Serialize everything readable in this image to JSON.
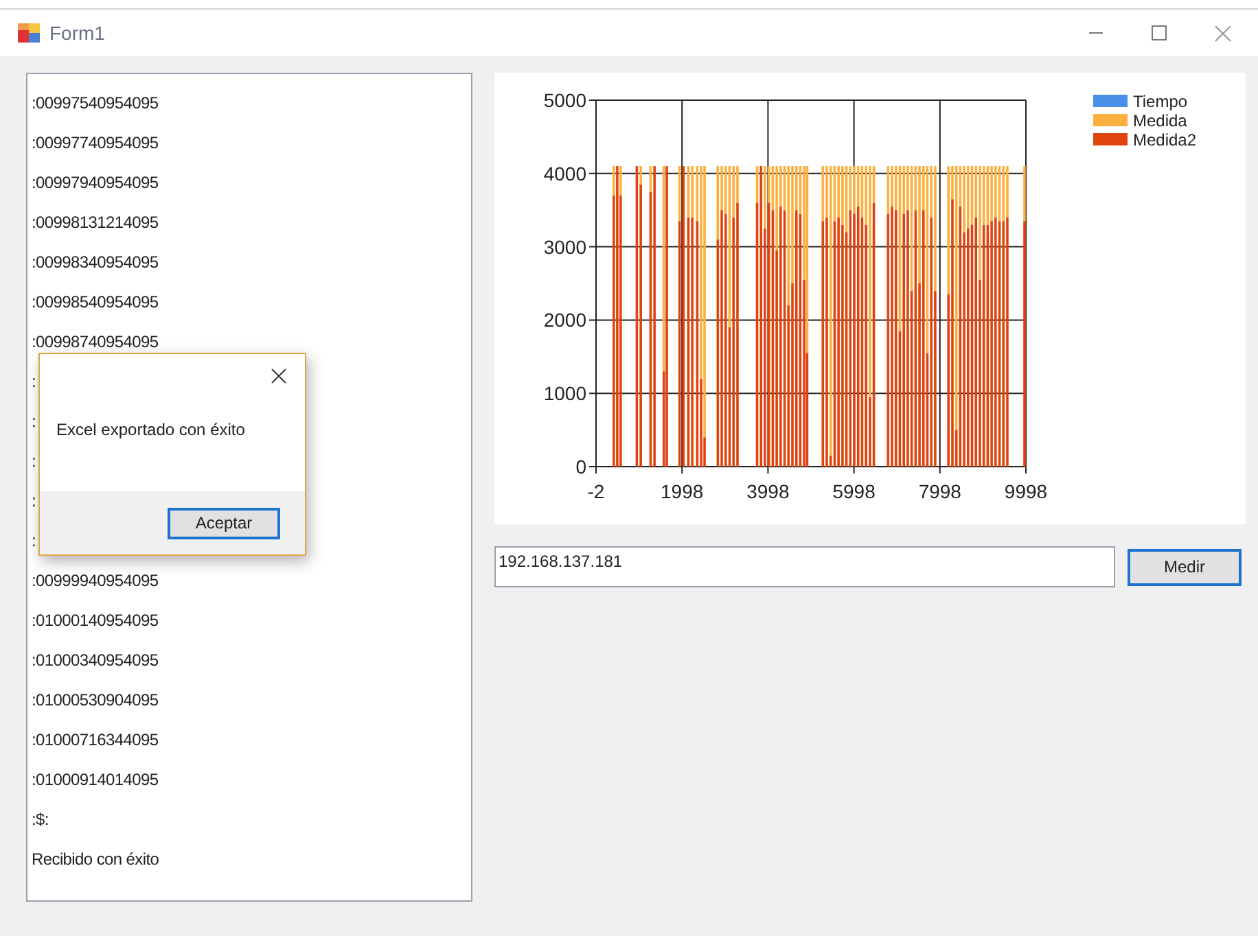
{
  "window": {
    "title": "Form1"
  },
  "log": {
    "items": [
      ":00997540954095",
      ":00997740954095",
      ":00997940954095",
      ":00998131214095",
      ":00998340954095",
      ":00998540954095",
      ":00998740954095",
      ":",
      ":",
      ":",
      ":",
      ":",
      ":00999940954095",
      ":01000140954095",
      ":01000340954095",
      ":01000530904095",
      ":01000716344095",
      ":01000914014095",
      ":$:",
      "Recibido con éxito"
    ]
  },
  "chart": {
    "chart_data": {
      "type": "bar",
      "stacked": true,
      "grid": true,
      "legend": "upper right",
      "xlim": [
        -2,
        9998
      ],
      "ylim": [
        0,
        5000
      ],
      "xticks": [
        -2,
        1998,
        3998,
        5998,
        7998,
        9998
      ],
      "yticks": [
        0,
        1000,
        2000,
        3000,
        4000,
        5000
      ],
      "x": [
        411,
        491,
        571,
        947,
        1039,
        1267,
        1358,
        1575,
        1644,
        1941,
        2032,
        2146,
        2237,
        2352,
        2443,
        2523,
        2831,
        2922,
        3014,
        3105,
        3196,
        3288,
        3744,
        3836,
        3927,
        4018,
        4110,
        4201,
        4292,
        4384,
        4475,
        4566,
        4658,
        4749,
        4840,
        4909,
        5274,
        5365,
        5457,
        5548,
        5639,
        5731,
        5822,
        5913,
        6005,
        6096,
        6187,
        6279,
        6370,
        6461,
        6792,
        6884,
        6975,
        7066,
        7158,
        7249,
        7340,
        7432,
        7523,
        7614,
        7705,
        7797,
        7888,
        8196,
        8288,
        8379,
        8470,
        8562,
        8653,
        8744,
        8836,
        8927,
        9018,
        9110,
        9201,
        9292,
        9384,
        9475,
        9566,
        9966
      ],
      "series": [
        {
          "name": "Tiempo",
          "color": "#4a90e8",
          "values": [
            0,
            0,
            0,
            0,
            0,
            0,
            0,
            0,
            0,
            0,
            0,
            0,
            0,
            0,
            0,
            0,
            0,
            0,
            0,
            0,
            0,
            0,
            0,
            0,
            0,
            0,
            0,
            0,
            0,
            0,
            0,
            0,
            0,
            0,
            0,
            0,
            0,
            0,
            0,
            0,
            0,
            0,
            0,
            0,
            0,
            0,
            0,
            0,
            0,
            0,
            0,
            0,
            0,
            0,
            0,
            0,
            0,
            0,
            0,
            0,
            0,
            0,
            0,
            0,
            0,
            0,
            0,
            0,
            0,
            0,
            0,
            0,
            0,
            0,
            0,
            0,
            0,
            0,
            0,
            0
          ]
        },
        {
          "name": "Medida",
          "color": "#fbb040",
          "values": [
            400,
            0,
            400,
            0,
            250,
            350,
            0,
            2800,
            0,
            750,
            0,
            700,
            700,
            750,
            2900,
            3700,
            1000,
            600,
            650,
            2200,
            700,
            500,
            500,
            0,
            850,
            500,
            600,
            1150,
            550,
            600,
            1900,
            1600,
            600,
            650,
            1550,
            2550,
            750,
            700,
            3950,
            750,
            700,
            800,
            900,
            600,
            650,
            550,
            700,
            800,
            3150,
            500,
            650,
            550,
            600,
            2250,
            650,
            600,
            1700,
            600,
            1600,
            600,
            2550,
            700,
            1700,
            1750,
            450,
            3600,
            550,
            900,
            850,
            800,
            700,
            1550,
            800,
            800,
            750,
            700,
            750,
            750,
            700,
            750
          ]
        },
        {
          "name": "Medida2",
          "color": "#e0440e",
          "values": [
            3700,
            4100,
            3700,
            4100,
            3850,
            3750,
            4100,
            1300,
            4100,
            3350,
            4100,
            3400,
            3400,
            3350,
            1200,
            400,
            3100,
            3500,
            3450,
            1900,
            3400,
            3600,
            3600,
            4100,
            3250,
            3600,
            3500,
            2950,
            3550,
            3500,
            2200,
            2500,
            3500,
            3450,
            2550,
            1550,
            3350,
            3400,
            150,
            3350,
            3400,
            3300,
            3200,
            3500,
            3450,
            3550,
            3400,
            3300,
            950,
            3600,
            3450,
            3550,
            3500,
            1850,
            3450,
            3500,
            2400,
            3500,
            2500,
            3500,
            1550,
            3400,
            2400,
            2350,
            3650,
            500,
            3550,
            3200,
            3250,
            3300,
            3400,
            2550,
            3300,
            3300,
            3350,
            3400,
            3350,
            3350,
            3400,
            3350
          ]
        }
      ]
    }
  },
  "address": {
    "value": "192.168.137.181"
  },
  "measure_button": {
    "label": "Medir"
  },
  "dialog": {
    "message": "Excel exportado con éxito",
    "button": "Aceptar"
  }
}
